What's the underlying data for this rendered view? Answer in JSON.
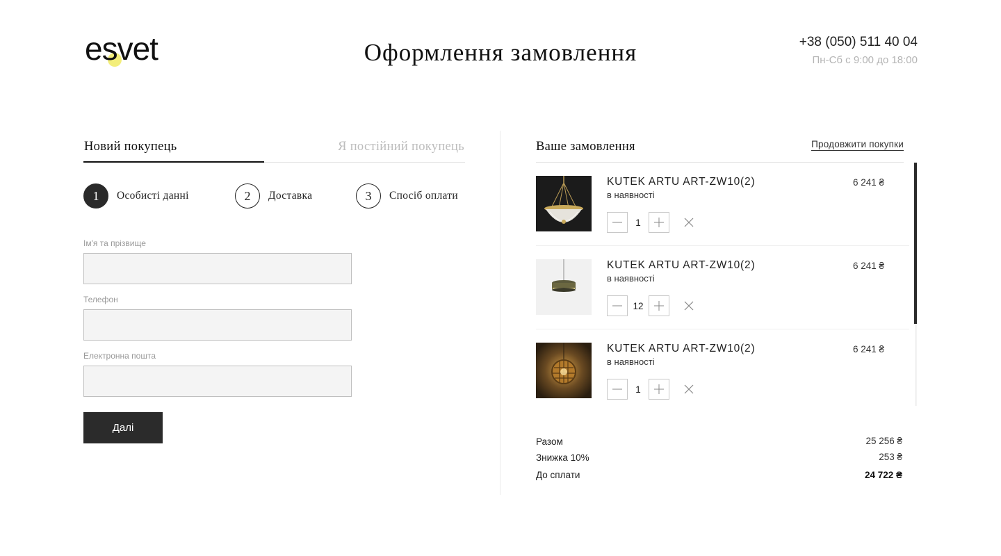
{
  "header": {
    "logo_text": "esvet",
    "title": "Оформлення замовлення",
    "phone": "+38 (050) 511 40 04",
    "hours": "Пн-Сб с 9:00 до 18:00"
  },
  "tabs": {
    "new_customer": "Новий покупець",
    "regular_customer": "Я постійний покупець"
  },
  "steps": [
    {
      "num": "1",
      "label": "Особисті данні"
    },
    {
      "num": "2",
      "label": "Доставка"
    },
    {
      "num": "3",
      "label": "Спосіб оплати"
    }
  ],
  "form": {
    "name_label": "Ім'я та прізвище",
    "phone_label": "Телефон",
    "email_label": "Електронна пошта",
    "next_label": "Далі"
  },
  "order": {
    "title": "Ваше замовлення",
    "continue_label": "Продовжити покупки",
    "items": [
      {
        "name": "KUTEK ARTU ART-ZW10(2)",
        "stock": "в наявності",
        "qty": "1",
        "price": "6 241 ₴"
      },
      {
        "name": "KUTEK ARTU ART-ZW10(2)",
        "stock": "в наявності",
        "qty": "12",
        "price": "6 241 ₴"
      },
      {
        "name": "KUTEK ARTU ART-ZW10(2)",
        "stock": "в наявності",
        "qty": "1",
        "price": "6 241 ₴"
      }
    ]
  },
  "totals": {
    "subtotal_label": "Разом",
    "subtotal_value": "25 256 ₴",
    "discount_label": "Знижка 10%",
    "discount_value": "253 ₴",
    "pay_label": "До сплати",
    "pay_value": "24 722 ₴"
  },
  "colors": {
    "dark": "#2b2b2b",
    "accent_logo": "#f3ee7a",
    "muted": "#bdbdbd",
    "input_bg": "#f4f4f4"
  }
}
